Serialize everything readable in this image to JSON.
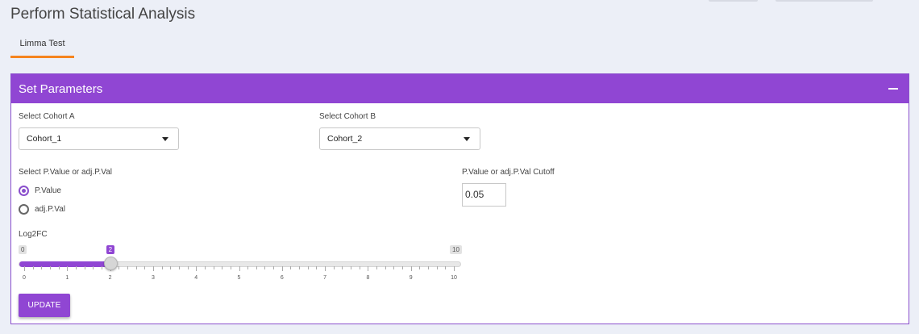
{
  "page": {
    "title": "Perform Statistical Analysis"
  },
  "tabs": [
    {
      "label": "Limma Test",
      "active": true
    }
  ],
  "panel": {
    "title": "Set Parameters",
    "cohort_a": {
      "label": "Select Cohort A",
      "value": "Cohort_1"
    },
    "cohort_b": {
      "label": "Select Cohort B",
      "value": "Cohort_2"
    },
    "pvalue_type": {
      "label": "Select P.Value or adj.P.Val",
      "options": [
        {
          "label": "P.Value",
          "checked": true
        },
        {
          "label": "adj.P.Val",
          "checked": false
        }
      ]
    },
    "cutoff": {
      "label": "P.Value or adj.P.Val Cutoff",
      "value": "0.05"
    },
    "log2fc": {
      "label": "Log2FC",
      "min": 0,
      "max": 10,
      "value": 2,
      "min_label": "0",
      "max_label": "10",
      "value_label": "2",
      "major_ticks": [
        "0",
        "1",
        "2",
        "3",
        "4",
        "5",
        "6",
        "7",
        "8",
        "9",
        "10"
      ]
    },
    "update_label": "UPDATE"
  },
  "colors": {
    "accent": "#9046d3",
    "tab_indicator": "#f5841f",
    "background": "#eceff7"
  }
}
